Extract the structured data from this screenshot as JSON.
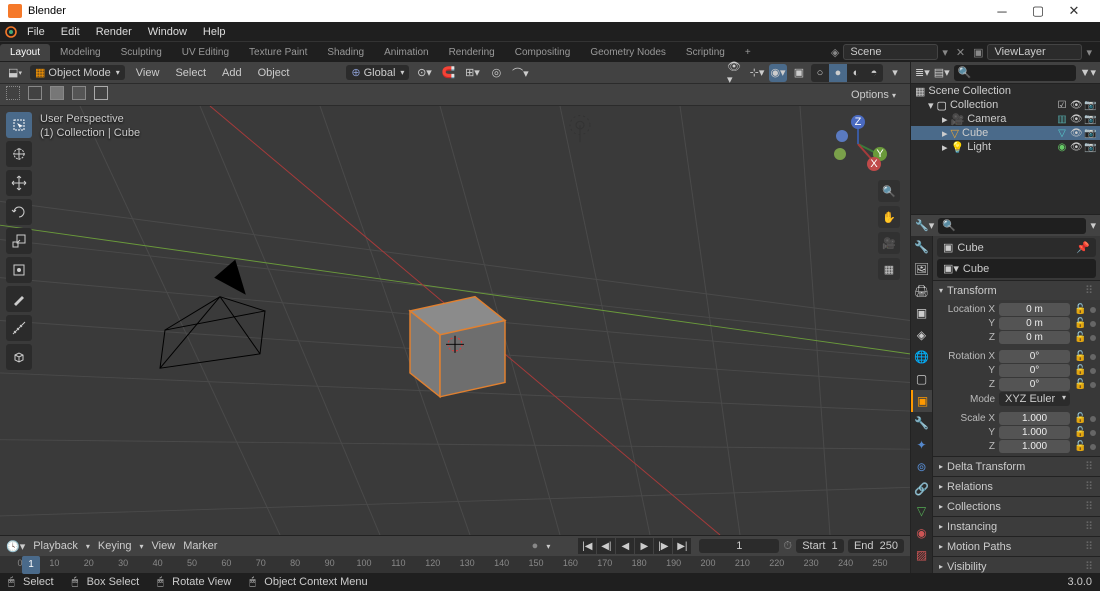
{
  "window": {
    "title": "Blender"
  },
  "menubar": [
    "File",
    "Edit",
    "Render",
    "Window",
    "Help"
  ],
  "workspaces": [
    "Layout",
    "Modeling",
    "Sculpting",
    "UV Editing",
    "Texture Paint",
    "Shading",
    "Animation",
    "Rendering",
    "Compositing",
    "Geometry Nodes",
    "Scripting"
  ],
  "active_workspace": 0,
  "scene": {
    "name": "Scene",
    "view_layer": "ViewLayer"
  },
  "viewport": {
    "mode": "Object Mode",
    "menus": [
      "View",
      "Select",
      "Add",
      "Object"
    ],
    "orientation": "Global",
    "overlay_line1": "User Perspective",
    "overlay_line2": "(1)  Collection | Cube",
    "options_label": "Options"
  },
  "outliner": {
    "root": "Scene Collection",
    "collection": "Collection",
    "items": [
      {
        "name": "Camera",
        "icon": "camera",
        "selected": false
      },
      {
        "name": "Cube",
        "icon": "mesh",
        "selected": true
      },
      {
        "name": "Light",
        "icon": "light",
        "selected": false
      }
    ]
  },
  "properties": {
    "breadcrumb1": "Cube",
    "breadcrumb2": "Cube",
    "transform_label": "Transform",
    "location_label": "Location X",
    "rotation_label": "Rotation X",
    "scale_label": "Scale X",
    "y_label": "Y",
    "z_label": "Z",
    "mode_label": "Mode",
    "rotation_mode": "XYZ Euler",
    "location": {
      "x": "0 m",
      "y": "0 m",
      "z": "0 m"
    },
    "rotation": {
      "x": "0°",
      "y": "0°",
      "z": "0°"
    },
    "scale": {
      "x": "1.000",
      "y": "1.000",
      "z": "1.000"
    },
    "panels": [
      "Delta Transform",
      "Relations",
      "Collections",
      "Instancing",
      "Motion Paths",
      "Visibility"
    ]
  },
  "timeline": {
    "menus": [
      "Playback",
      "Keying",
      "View",
      "Marker"
    ],
    "current": "1",
    "start_label": "Start",
    "start": "1",
    "end_label": "End",
    "end": "250",
    "ticks": [
      "0",
      "10",
      "20",
      "30",
      "40",
      "50",
      "60",
      "70",
      "80",
      "90",
      "100",
      "110",
      "120",
      "130",
      "140",
      "150",
      "160",
      "170",
      "180",
      "190",
      "200",
      "210",
      "220",
      "230",
      "240",
      "250"
    ]
  },
  "statusbar": {
    "select": "Select",
    "box": "Box Select",
    "rotate": "Rotate View",
    "menu": "Object Context Menu",
    "version": "3.0.0"
  }
}
